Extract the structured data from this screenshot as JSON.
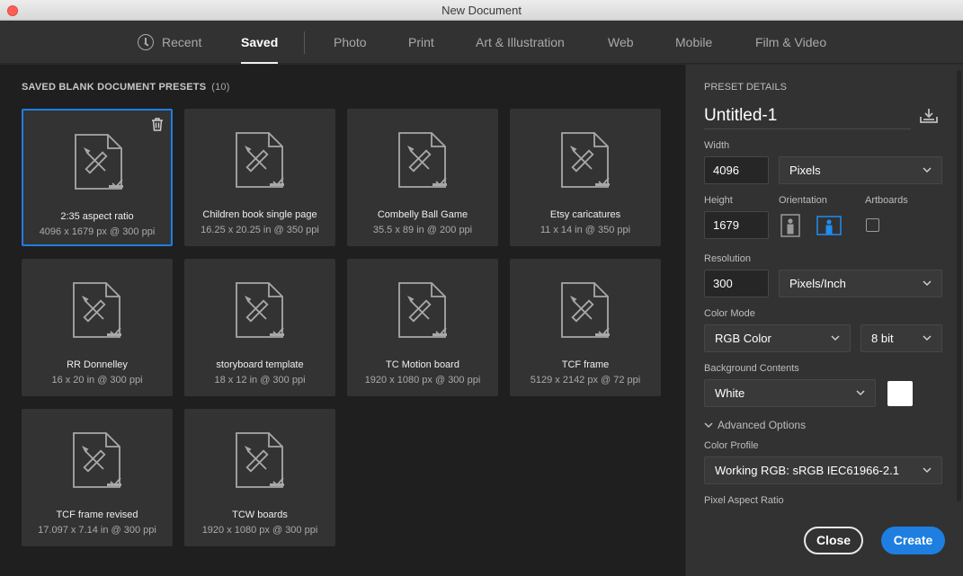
{
  "window": {
    "title": "New Document"
  },
  "tabs": [
    {
      "label": "Recent",
      "icon": "clock-icon",
      "active": false
    },
    {
      "label": "Saved",
      "active": true
    },
    {
      "label": "Photo",
      "active": false
    },
    {
      "label": "Print",
      "active": false
    },
    {
      "label": "Art & Illustration",
      "active": false
    },
    {
      "label": "Web",
      "active": false
    },
    {
      "label": "Mobile",
      "active": false
    },
    {
      "label": "Film & Video",
      "active": false
    }
  ],
  "presets": {
    "heading": "SAVED BLANK DOCUMENT PRESETS",
    "count": "(10)",
    "items": [
      {
        "name": "2:35 aspect ratio",
        "dims": "4096 x 1679 px @ 300 ppi",
        "selected": true
      },
      {
        "name": "Children book single page",
        "dims": "16.25 x 20.25 in @ 350 ppi"
      },
      {
        "name": "Combelly Ball Game",
        "dims": "35.5 x 89 in @ 200 ppi"
      },
      {
        "name": "Etsy caricatures",
        "dims": "11 x 14 in @ 350 ppi"
      },
      {
        "name": "RR Donnelley",
        "dims": "16 x 20 in @ 300 ppi"
      },
      {
        "name": "storyboard template",
        "dims": "18 x 12 in @ 300 ppi"
      },
      {
        "name": "TC Motion board",
        "dims": "1920 x 1080 px @ 300 ppi"
      },
      {
        "name": "TCF frame",
        "dims": "5129 x 2142 px @ 72 ppi"
      },
      {
        "name": "TCF frame revised",
        "dims": "17.097 x 7.14 in @ 300 ppi"
      },
      {
        "name": "TCW boards",
        "dims": "1920 x 1080 px @ 300 ppi"
      }
    ]
  },
  "details": {
    "heading": "PRESET DETAILS",
    "doc_name": "Untitled-1",
    "width_label": "Width",
    "width_value": "4096",
    "width_unit": "Pixels",
    "height_label": "Height",
    "height_value": "1679",
    "orientation_label": "Orientation",
    "orientation_selected": "landscape",
    "artboards_label": "Artboards",
    "artboards_checked": false,
    "resolution_label": "Resolution",
    "resolution_value": "300",
    "resolution_unit": "Pixels/Inch",
    "color_mode_label": "Color Mode",
    "color_mode": "RGB Color",
    "bit_depth": "8 bit",
    "bg_label": "Background Contents",
    "bg_value": "White",
    "bg_color": "#ffffff",
    "advanced_label": "Advanced Options",
    "color_profile_label": "Color Profile",
    "color_profile": "Working RGB: sRGB IEC61966-2.1",
    "pixel_aspect_label": "Pixel Aspect Ratio"
  },
  "buttons": {
    "close": "Close",
    "create": "Create"
  },
  "colors": {
    "accent": "#1e7fe0",
    "panel": "#323232",
    "grid_bg": "#1f1f1f",
    "card": "#333333"
  }
}
